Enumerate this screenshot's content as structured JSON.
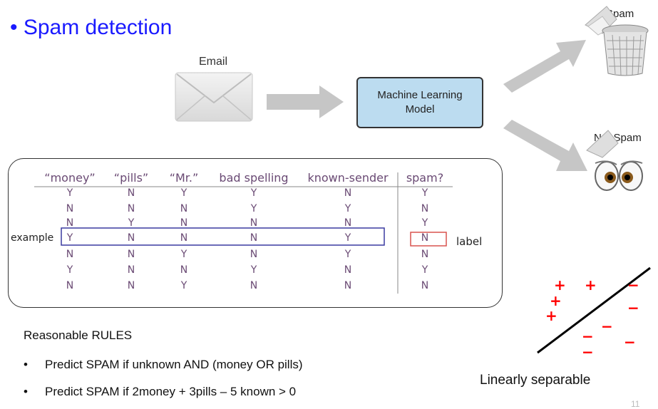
{
  "title": "• Spam detection",
  "email_label": "Email",
  "model": {
    "line1": "Machine Learning",
    "line2": "Model"
  },
  "outputs": {
    "spam": "Spam",
    "not_spam": "Not Spam"
  },
  "table": {
    "headers": [
      "“money”",
      "“pills”",
      "“Mr.”",
      "bad spelling",
      "known-sender",
      "spam?"
    ],
    "rows": [
      [
        "Y",
        "N",
        "Y",
        "Y",
        "N",
        "Y"
      ],
      [
        "N",
        "N",
        "N",
        "Y",
        "Y",
        "N"
      ],
      [
        "N",
        "Y",
        "N",
        "N",
        "N",
        "Y"
      ],
      [
        "Y",
        "N",
        "N",
        "N",
        "Y",
        "N"
      ],
      [
        "N",
        "N",
        "Y",
        "N",
        "Y",
        "N"
      ],
      [
        "Y",
        "N",
        "N",
        "Y",
        "N",
        "Y"
      ],
      [
        "N",
        "N",
        "Y",
        "N",
        "N",
        "N"
      ]
    ],
    "example_label": "example",
    "label_label": "label"
  },
  "rules": {
    "heading": "Reasonable RULES",
    "items": [
      "Predict SPAM if unknown AND (money OR pills)",
      "Predict SPAM if 2money + 3pills – 5 known > 0"
    ]
  },
  "separable_label": "Linearly separable",
  "page_number": "11",
  "colors": {
    "title": "#1a1aff",
    "model_fill": "#bcdcf0",
    "plus": "#ff0000",
    "minus": "#ff0000"
  }
}
